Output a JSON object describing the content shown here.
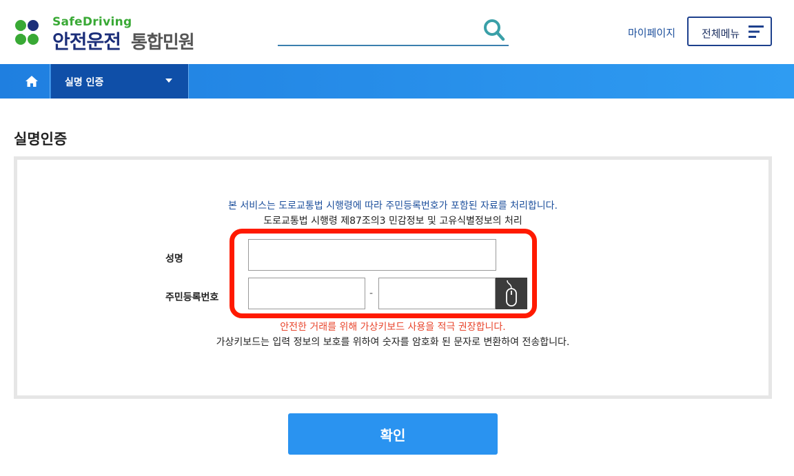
{
  "header": {
    "logo_sub": "SafeDriving",
    "logo_main": "안전운전",
    "logo_main2": "통합민원",
    "search": {
      "value": "",
      "placeholder": ""
    },
    "mypage_label": "마이페이지",
    "allmenu_label": "전체메뉴"
  },
  "nav": {
    "current": "실명 인증"
  },
  "main": {
    "title": "실명인증",
    "notice_1": "본 서비스는 도로교통법 시행령에 따라 주민등록번호가 포함된 자료를 처리합니다.",
    "notice_2": "도로교통법 시행령 제87조의3 민감정보 및 고유식별정보의 처리",
    "name_label": "성명",
    "rrn_label": "주민등록번호",
    "dash": "-",
    "warning": "안전한 거래를 위해 가상키보드 사용을 적극 권장합니다.",
    "description": "가상키보드는 입력 정보의 보호를 위하여 숫자를 암호화 된 문자로 변환하여 전송합니다.",
    "confirm_label": "확인"
  },
  "colors": {
    "brand_navy": "#1c2f7a",
    "brand_green": "#39a935",
    "nav_blue": "#2f9cf2",
    "nav_dark": "#0f4fa8",
    "button_blue": "#2a93f0",
    "warning_red": "#e8452c",
    "highlight_red": "#ff1a00"
  },
  "icons": [
    "clover-logo-icon",
    "search-icon",
    "hamburger-menu-icon",
    "home-icon",
    "caret-down-icon",
    "mouse-icon"
  ]
}
